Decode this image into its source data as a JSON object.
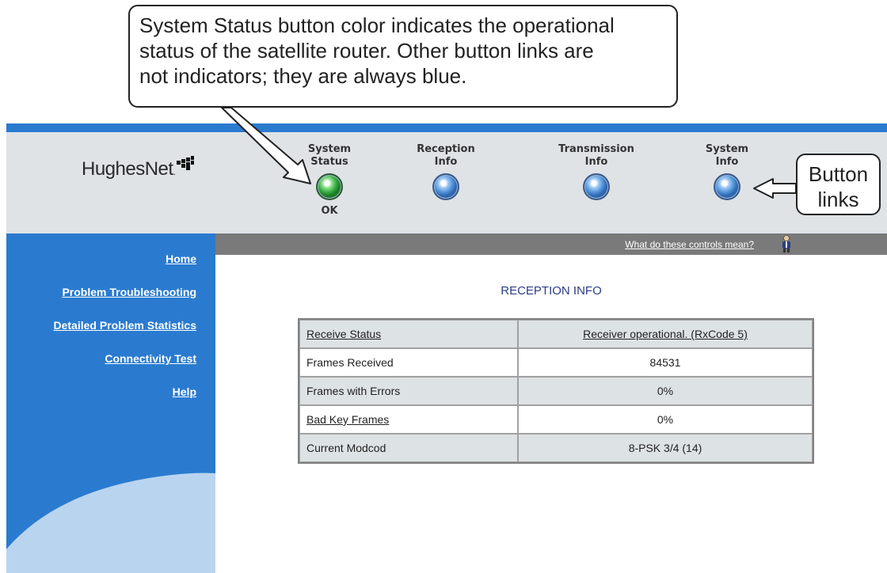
{
  "annotations": {
    "top_callout_lines": [
      "System Status button color indicates the operational",
      "status of the satellite router. Other button links are",
      "not indicators; they are always blue."
    ],
    "button_callout_lines": [
      "Button",
      "links"
    ]
  },
  "header": {
    "logo_text": "HughesNet",
    "logo_suffix": "."
  },
  "nav": {
    "system_status": {
      "line1": "System",
      "line2": "Status",
      "status": "OK",
      "color": "green"
    },
    "reception_info": {
      "line1": "Reception",
      "line2": "Info",
      "color": "blue"
    },
    "transmission_info": {
      "line1": "Transmission",
      "line2": "Info",
      "color": "blue"
    },
    "system_info": {
      "line1": "System",
      "line2": "Info",
      "color": "blue"
    }
  },
  "control_bar": {
    "help_link": "What do these controls mean?"
  },
  "sidebar": {
    "items": [
      {
        "label": "Home"
      },
      {
        "label": "Problem Troubleshooting"
      },
      {
        "label": "Detailed Problem Statistics"
      },
      {
        "label": "Connectivity Test"
      },
      {
        "label": "Help"
      }
    ]
  },
  "main": {
    "title": "RECEPTION INFO",
    "rows": [
      {
        "label": "Receive Status",
        "value": "Receiver operational. (RxCode 5)"
      },
      {
        "label": "Frames Received",
        "value": "84531"
      },
      {
        "label": "Frames with Errors",
        "value": "0%"
      },
      {
        "label": "Bad Key Frames",
        "value": "0%"
      },
      {
        "label": "Current Modcod",
        "value": "8-PSK 3/4 (14)"
      }
    ]
  },
  "colors": {
    "sidebar_blue": "#2a7bcf",
    "header_gray": "#dfe3e6",
    "control_bar_gray": "#7a7a7a",
    "title_navy": "#2b3d87",
    "status_ok_green": "#2fa73c",
    "link_blue": "#4c8fd6"
  }
}
